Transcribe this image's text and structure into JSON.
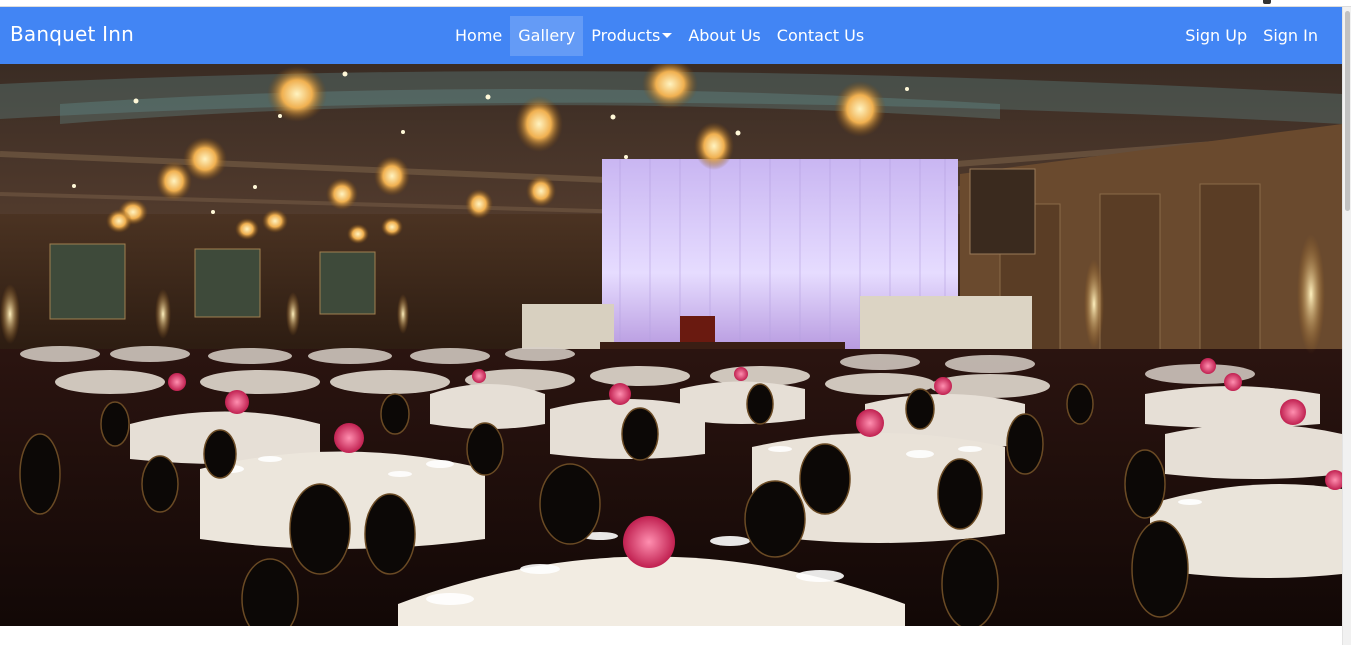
{
  "navbar": {
    "brand": "Banquet Inn",
    "links": [
      {
        "label": "Home",
        "active": false
      },
      {
        "label": "Gallery",
        "active": true
      },
      {
        "label": "Products",
        "active": false
      },
      {
        "label": "About Us",
        "active": false
      },
      {
        "label": "Contact Us",
        "active": false
      }
    ],
    "right_links": [
      {
        "label": "Sign Up"
      },
      {
        "label": "Sign In"
      }
    ],
    "color": "#4285f4"
  },
  "hero": {
    "icon": "banquet-hall-photo"
  }
}
